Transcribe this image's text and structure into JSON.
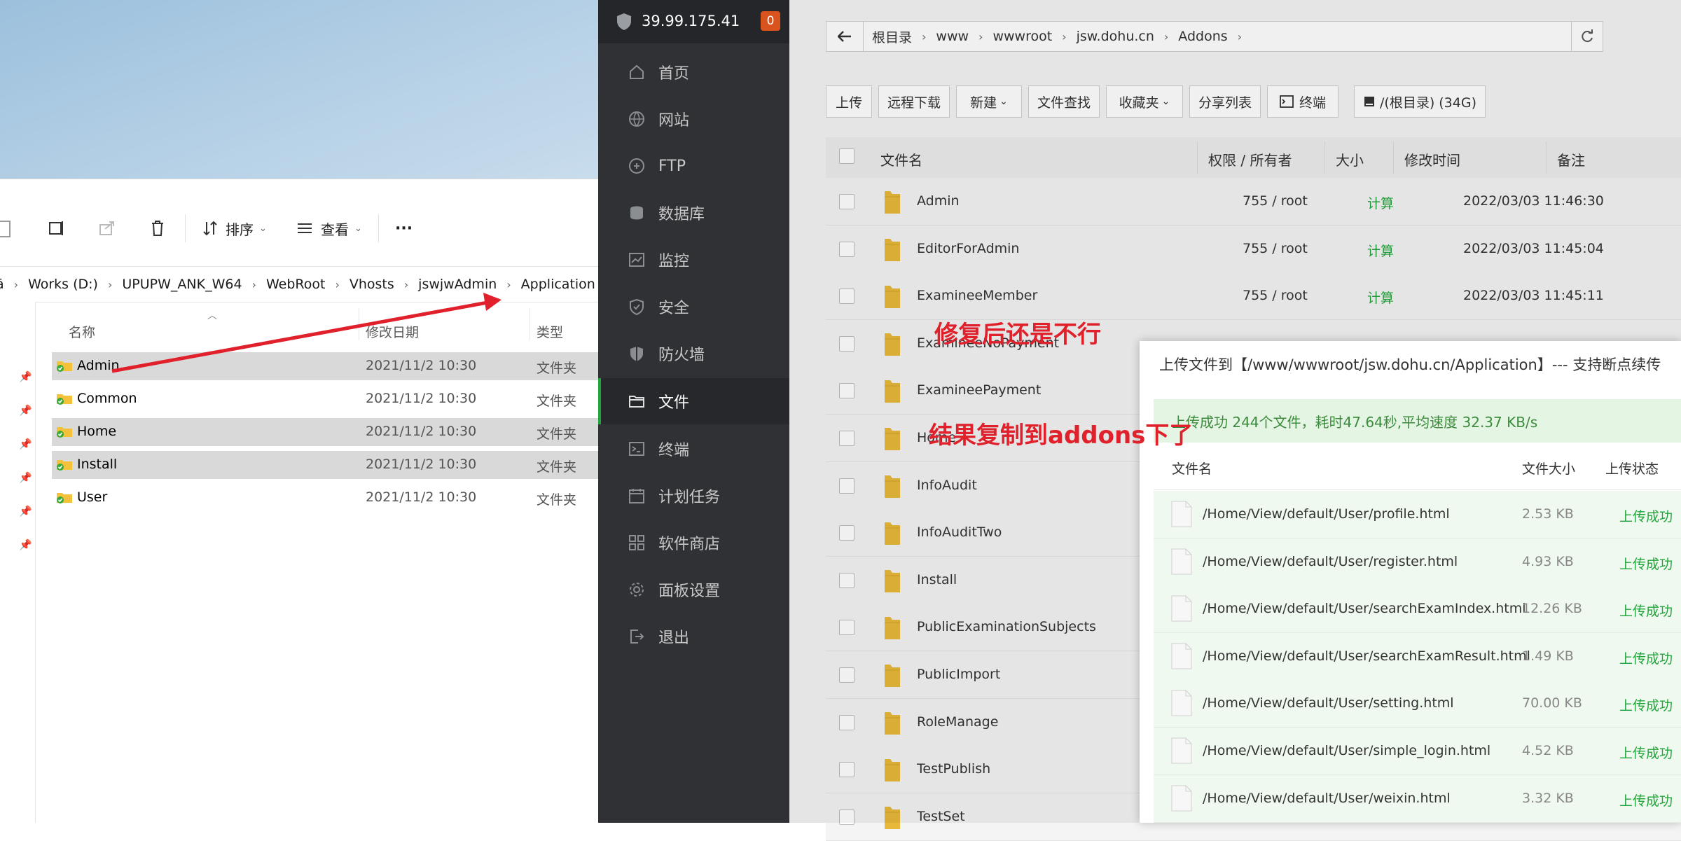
{
  "explorer": {
    "toolbar": {
      "sort_label": "排序",
      "view_label": "查看",
      "more_label": "···"
    },
    "breadcrumb": [
      "Works (D:)",
      "UPUPW_ANK_W64",
      "WebRoot",
      "Vhosts",
      "jswjwAdmin",
      "Application"
    ],
    "breadcrumb_lead": "ā",
    "columns": {
      "name": "名称",
      "date": "修改日期",
      "type": "类型"
    },
    "rows": [
      {
        "name": "Admin",
        "date": "2021/11/2 10:30",
        "type": "文件夹",
        "selected": true
      },
      {
        "name": "Common",
        "date": "2021/11/2 10:30",
        "type": "文件夹",
        "selected": false
      },
      {
        "name": "Home",
        "date": "2021/11/2 10:30",
        "type": "文件夹",
        "selected": true
      },
      {
        "name": "Install",
        "date": "2021/11/2 10:30",
        "type": "文件夹",
        "selected": true
      },
      {
        "name": "User",
        "date": "2021/11/2 10:30",
        "type": "文件夹",
        "selected": false
      }
    ]
  },
  "sidebar": {
    "ip": "39.99.175.41",
    "badge": "0",
    "items": [
      {
        "label": "首页",
        "icon": "home-icon"
      },
      {
        "label": "网站",
        "icon": "globe-icon"
      },
      {
        "label": "FTP",
        "icon": "ftp-icon"
      },
      {
        "label": "数据库",
        "icon": "database-icon"
      },
      {
        "label": "监控",
        "icon": "monitor-icon"
      },
      {
        "label": "安全",
        "icon": "shield-check-icon"
      },
      {
        "label": "防火墙",
        "icon": "firewall-icon"
      },
      {
        "label": "文件",
        "icon": "folder-icon",
        "active": true
      },
      {
        "label": "终端",
        "icon": "terminal-icon"
      },
      {
        "label": "计划任务",
        "icon": "calendar-icon"
      },
      {
        "label": "软件商店",
        "icon": "apps-icon"
      },
      {
        "label": "面板设置",
        "icon": "gear-icon"
      },
      {
        "label": "退出",
        "icon": "logout-icon"
      }
    ]
  },
  "files": {
    "path": [
      "根目录",
      "www",
      "wwwroot",
      "jsw.dohu.cn",
      "Addons"
    ],
    "buttons": {
      "upload": "上传",
      "remote_download": "远程下载",
      "new": "新建",
      "search": "文件查找",
      "favorites": "收藏夹",
      "share_list": "分享列表",
      "terminal": "终端",
      "disk": "/(根目录) (34G)"
    },
    "columns": {
      "name": "文件名",
      "perm": "权限 / 所有者",
      "size": "大小",
      "mtime": "修改时间",
      "note": "备注"
    },
    "rows": [
      {
        "name": "Admin",
        "perm": "755 / root",
        "size": "计算",
        "mtime": "2022/03/03 11:46:30"
      },
      {
        "name": "EditorForAdmin",
        "perm": "755 / root",
        "size": "计算",
        "mtime": "2022/03/03 11:45:04"
      },
      {
        "name": "ExamineeMember",
        "perm": "755 / root",
        "size": "计算",
        "mtime": "2022/03/03 11:45:11"
      },
      {
        "name": "ExamineeNoPayment",
        "perm": "",
        "size": "",
        "mtime": ""
      },
      {
        "name": "ExamineePayment",
        "perm": "",
        "size": "",
        "mtime": ""
      },
      {
        "name": "Home",
        "perm": "",
        "size": "",
        "mtime": ""
      },
      {
        "name": "InfoAudit",
        "perm": "",
        "size": "",
        "mtime": ""
      },
      {
        "name": "InfoAuditTwo",
        "perm": "",
        "size": "",
        "mtime": ""
      },
      {
        "name": "Install",
        "perm": "",
        "size": "",
        "mtime": ""
      },
      {
        "name": "PublicExaminationSubjects",
        "perm": "",
        "size": "",
        "mtime": ""
      },
      {
        "name": "PublicImport",
        "perm": "",
        "size": "",
        "mtime": ""
      },
      {
        "name": "RoleManage",
        "perm": "",
        "size": "",
        "mtime": ""
      },
      {
        "name": "TestPublish",
        "perm": "",
        "size": "",
        "mtime": ""
      },
      {
        "name": "TestSet",
        "perm": "",
        "size": "",
        "mtime": ""
      }
    ]
  },
  "upload_dialog": {
    "title": "上传文件到【/www/wwwroot/jsw.dohu.cn/Application】--- 支持断点续传",
    "status": "上传成功 244个文件，耗时47.64秒,平均速度 32.37 KB/s",
    "columns": {
      "name": "文件名",
      "size": "文件大小",
      "state": "上传状态"
    },
    "rows": [
      {
        "name": "/Home/View/default/User/profile.html",
        "size": "2.53 KB",
        "state": "上传成功"
      },
      {
        "name": "/Home/View/default/User/register.html",
        "size": "4.93 KB",
        "state": "上传成功"
      },
      {
        "name": "/Home/View/default/User/searchExamIndex.html",
        "size": "12.26 KB",
        "state": "上传成功"
      },
      {
        "name": "/Home/View/default/User/searchExamResult.html",
        "size": "1.49 KB",
        "state": "上传成功"
      },
      {
        "name": "/Home/View/default/User/setting.html",
        "size": "70.00 KB",
        "state": "上传成功"
      },
      {
        "name": "/Home/View/default/User/simple_login.html",
        "size": "4.52 KB",
        "state": "上传成功"
      },
      {
        "name": "/Home/View/default/User/weixin.html",
        "size": "3.32 KB",
        "state": "上传成功"
      }
    ]
  },
  "annotations": {
    "note1": "修复后还是不行",
    "note2": "结果复制到addons下了"
  },
  "colors": {
    "accent_green": "#20a53a",
    "annotation_red": "#e0202a",
    "sidebar_bg": "#2f3134"
  }
}
